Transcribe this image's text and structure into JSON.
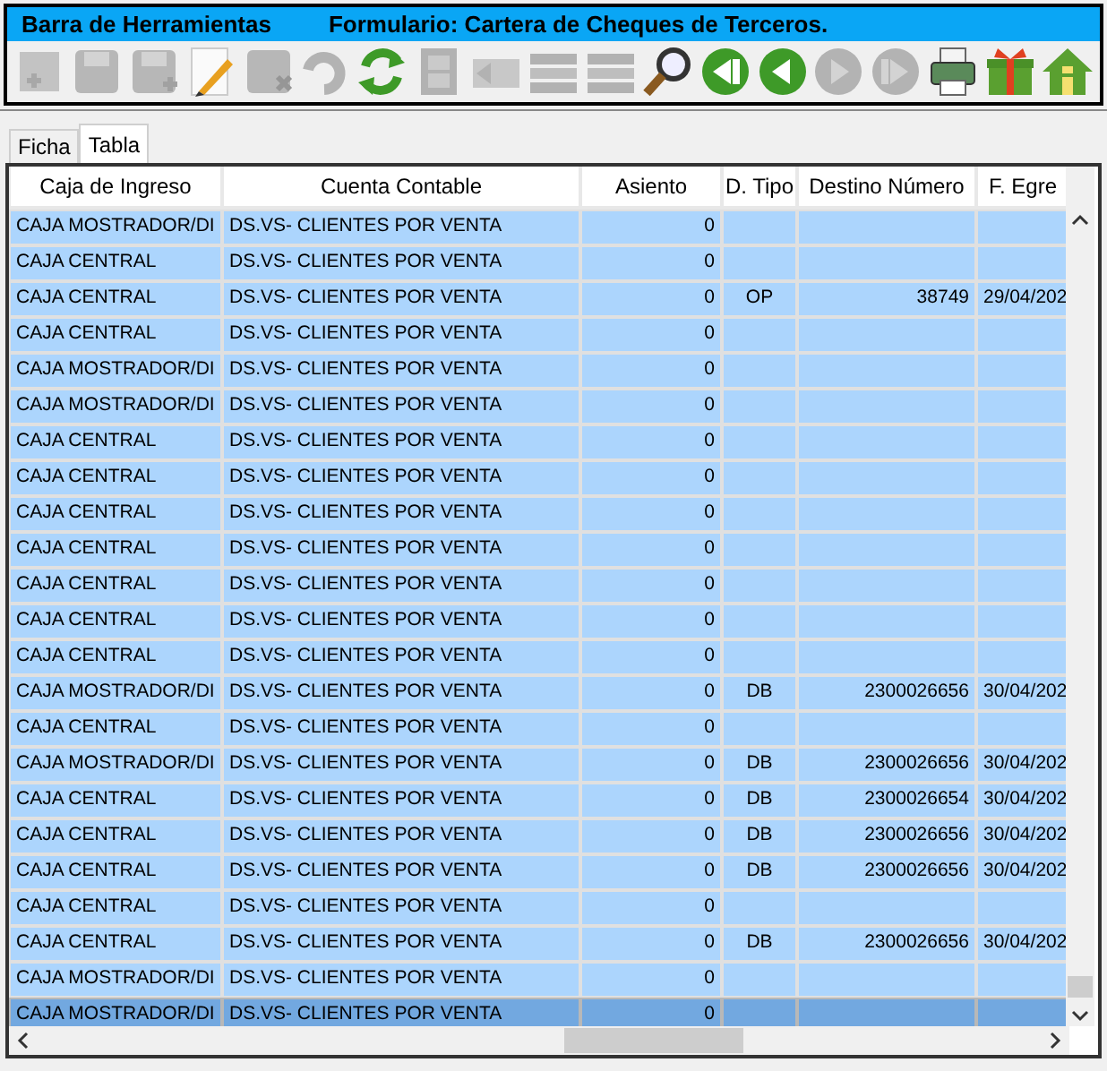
{
  "title_bar": {
    "toolbar_title": "Barra de Herramientas",
    "form_title": "Formulario: Cartera de Cheques de Terceros."
  },
  "toolbar": [
    {
      "kind": "add",
      "disabled": true
    },
    {
      "kind": "save",
      "disabled": true
    },
    {
      "kind": "save-as",
      "disabled": true
    },
    {
      "kind": "edit",
      "disabled": false
    },
    {
      "kind": "delete",
      "disabled": true
    },
    {
      "kind": "undo",
      "disabled": true
    },
    {
      "kind": "refresh",
      "disabled": false
    },
    {
      "kind": "film",
      "disabled": true
    },
    {
      "kind": "back",
      "disabled": true
    },
    {
      "kind": "list",
      "disabled": true
    },
    {
      "kind": "list",
      "disabled": true
    },
    {
      "kind": "search",
      "disabled": false
    },
    {
      "kind": "first",
      "disabled": false
    },
    {
      "kind": "prev",
      "disabled": false
    },
    {
      "kind": "next",
      "disabled": true
    },
    {
      "kind": "last",
      "disabled": true
    },
    {
      "kind": "print",
      "disabled": false
    },
    {
      "kind": "gift",
      "disabled": false
    },
    {
      "kind": "home",
      "disabled": false
    }
  ],
  "tabs": [
    {
      "label": "Ficha",
      "selected": false
    },
    {
      "label": "Tabla",
      "selected": true
    }
  ],
  "table": {
    "columns": [
      "Caja de Ingreso",
      "Cuenta Contable",
      "Asiento",
      "D. Tipo",
      "Destino Número",
      "F. Egre"
    ],
    "rows": [
      {
        "cells": [
          "CAJA MOSTRADOR/DI",
          "DS.VS- CLIENTES POR VENTA",
          "0",
          "",
          "",
          ""
        ],
        "selected": false
      },
      {
        "cells": [
          "CAJA CENTRAL",
          "DS.VS- CLIENTES POR VENTA",
          "0",
          "",
          "",
          ""
        ],
        "selected": false
      },
      {
        "cells": [
          "CAJA CENTRAL",
          "DS.VS- CLIENTES POR VENTA",
          "0",
          "OP",
          "38749",
          "29/04/202"
        ],
        "selected": false
      },
      {
        "cells": [
          "CAJA CENTRAL",
          "DS.VS- CLIENTES POR VENTA",
          "0",
          "",
          "",
          ""
        ],
        "selected": false
      },
      {
        "cells": [
          "CAJA MOSTRADOR/DI",
          "DS.VS- CLIENTES POR VENTA",
          "0",
          "",
          "",
          ""
        ],
        "selected": false
      },
      {
        "cells": [
          "CAJA MOSTRADOR/DI",
          "DS.VS- CLIENTES POR VENTA",
          "0",
          "",
          "",
          ""
        ],
        "selected": false
      },
      {
        "cells": [
          "CAJA CENTRAL",
          "DS.VS- CLIENTES POR VENTA",
          "0",
          "",
          "",
          ""
        ],
        "selected": false
      },
      {
        "cells": [
          "CAJA CENTRAL",
          "DS.VS- CLIENTES POR VENTA",
          "0",
          "",
          "",
          ""
        ],
        "selected": false
      },
      {
        "cells": [
          "CAJA CENTRAL",
          "DS.VS- CLIENTES POR VENTA",
          "0",
          "",
          "",
          ""
        ],
        "selected": false
      },
      {
        "cells": [
          "CAJA CENTRAL",
          "DS.VS- CLIENTES POR VENTA",
          "0",
          "",
          "",
          ""
        ],
        "selected": false
      },
      {
        "cells": [
          "CAJA CENTRAL",
          "DS.VS- CLIENTES POR VENTA",
          "0",
          "",
          "",
          ""
        ],
        "selected": false
      },
      {
        "cells": [
          "CAJA CENTRAL",
          "DS.VS- CLIENTES POR VENTA",
          "0",
          "",
          "",
          ""
        ],
        "selected": false
      },
      {
        "cells": [
          "CAJA CENTRAL",
          "DS.VS- CLIENTES POR VENTA",
          "0",
          "",
          "",
          ""
        ],
        "selected": false
      },
      {
        "cells": [
          "CAJA MOSTRADOR/DI",
          "DS.VS- CLIENTES POR VENTA",
          "0",
          "DB",
          "2300026656",
          "30/04/202"
        ],
        "selected": false
      },
      {
        "cells": [
          "CAJA CENTRAL",
          "DS.VS- CLIENTES POR VENTA",
          "0",
          "",
          "",
          ""
        ],
        "selected": false
      },
      {
        "cells": [
          "CAJA MOSTRADOR/DI",
          "DS.VS- CLIENTES POR VENTA",
          "0",
          "DB",
          "2300026656",
          "30/04/202"
        ],
        "selected": false
      },
      {
        "cells": [
          "CAJA CENTRAL",
          "DS.VS- CLIENTES POR VENTA",
          "0",
          "DB",
          "2300026654",
          "30/04/202"
        ],
        "selected": false
      },
      {
        "cells": [
          "CAJA CENTRAL",
          "DS.VS- CLIENTES POR VENTA",
          "0",
          "DB",
          "2300026656",
          "30/04/202"
        ],
        "selected": false
      },
      {
        "cells": [
          "CAJA CENTRAL",
          "DS.VS- CLIENTES POR VENTA",
          "0",
          "DB",
          "2300026656",
          "30/04/202"
        ],
        "selected": false
      },
      {
        "cells": [
          "CAJA CENTRAL",
          "DS.VS- CLIENTES POR VENTA",
          "0",
          "",
          "",
          ""
        ],
        "selected": false
      },
      {
        "cells": [
          "CAJA CENTRAL",
          "DS.VS- CLIENTES POR VENTA",
          "0",
          "DB",
          "2300026656",
          "30/04/202"
        ],
        "selected": false
      },
      {
        "cells": [
          "CAJA MOSTRADOR/DI",
          "DS.VS- CLIENTES POR VENTA",
          "0",
          "",
          "",
          ""
        ],
        "selected": false
      },
      {
        "cells": [
          "CAJA MOSTRADOR/DI",
          "DS.VS- CLIENTES POR VENTA",
          "0",
          "",
          "",
          ""
        ],
        "selected": true
      }
    ]
  }
}
